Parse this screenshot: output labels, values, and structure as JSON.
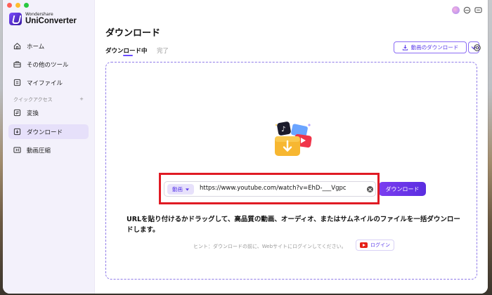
{
  "app": {
    "brand_small": "Wondershare",
    "brand_big": "UniConverter"
  },
  "sidebar": {
    "items": [
      {
        "label": "ホーム",
        "icon": "home-icon"
      },
      {
        "label": "その他のツール",
        "icon": "toolbox-icon"
      },
      {
        "label": "マイファイル",
        "icon": "folder-icon"
      }
    ],
    "section_label": "クイックアクセス",
    "section_add": "+",
    "quick_items": [
      {
        "label": "変換",
        "icon": "convert-icon"
      },
      {
        "label": "ダウンロード",
        "icon": "download-icon",
        "active": true
      },
      {
        "label": "動画圧縮",
        "icon": "compress-icon"
      }
    ]
  },
  "main": {
    "title": "ダウンロード",
    "tabs": [
      {
        "label": "ダウンロード中",
        "active": true
      },
      {
        "label": "完了",
        "active": false
      }
    ],
    "download_video_button": "動画のダウンロード",
    "url_input": {
      "type_label": "動画",
      "value": "https://www.youtube.com/watch?v=EhD-___Vgpc"
    },
    "download_button": "ダウンロード",
    "description": "URLを貼り付けるかドラッグして、高品質の動画、オーディオ、またはサムネイルのファイルを一括ダウンロードします。",
    "hint": "ヒント：ダウンロードの前に、Webサイトにログインしてください。",
    "login_button": "ログイン"
  },
  "colors": {
    "accent": "#6b4dff",
    "highlight": "#e01b24",
    "sidebar_bg": "#f3f1fb"
  }
}
